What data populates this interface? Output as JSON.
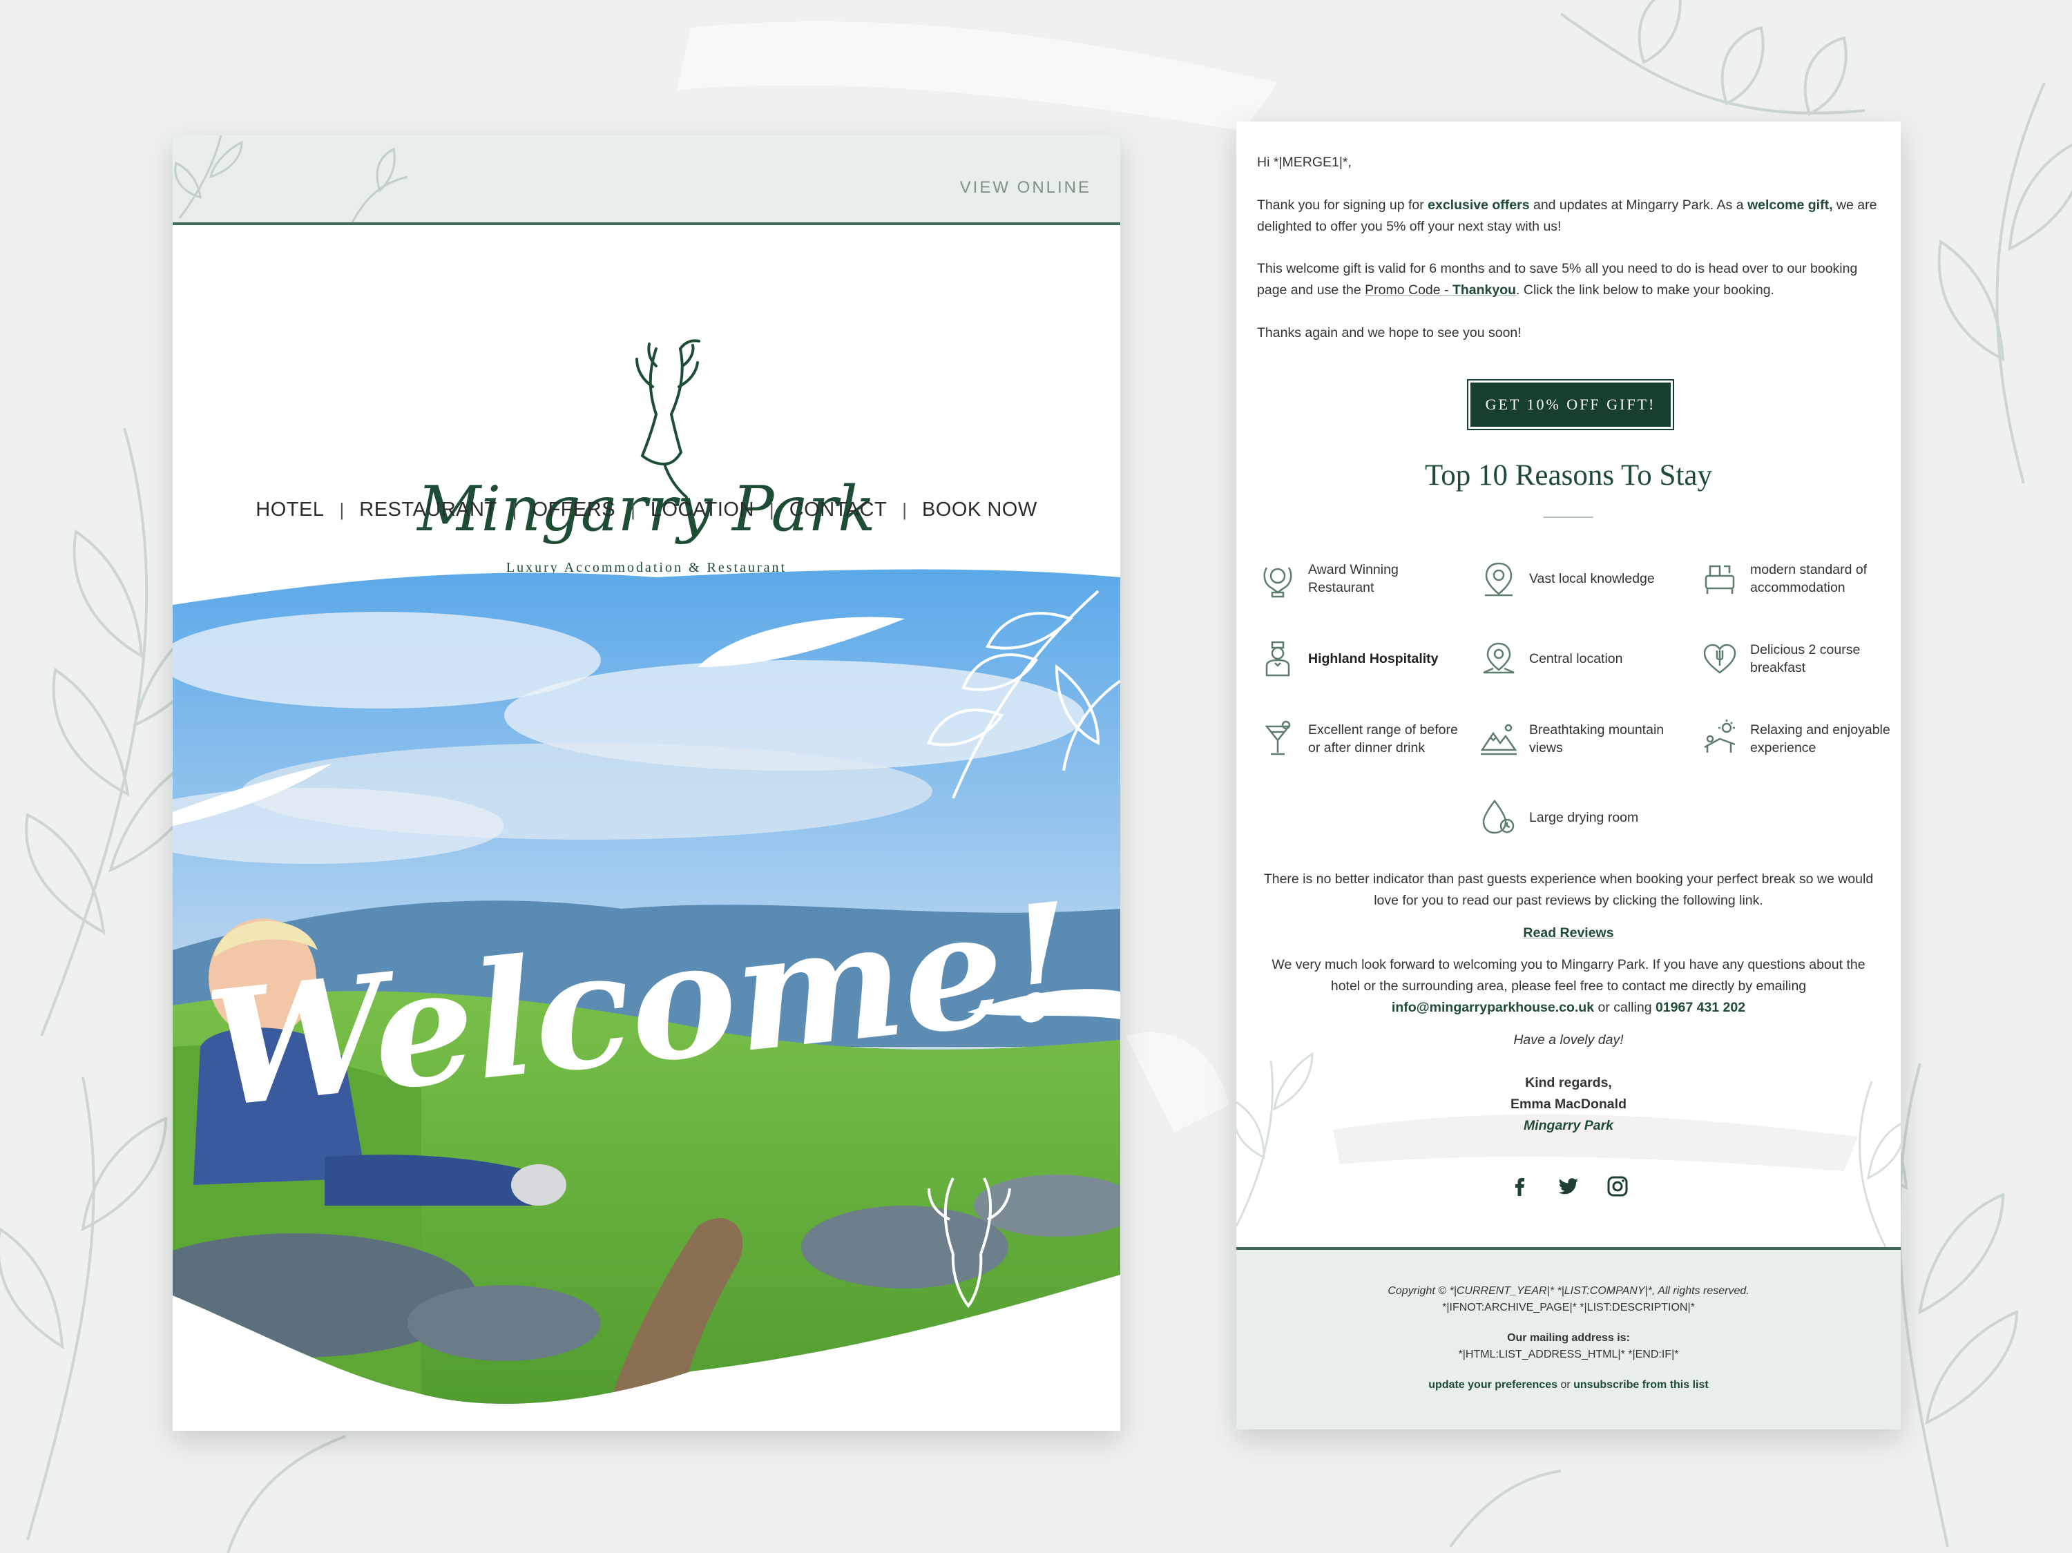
{
  "left_email": {
    "view_online": "VIEW ONLINE",
    "brand_name": "Mingarry Park",
    "brand_tagline": "Luxury Accommodation & Restaurant",
    "nav": [
      "HOTEL",
      "RESTAURANT",
      "OFFERS",
      "LOCATION",
      "CONTACT",
      "BOOK NOW"
    ],
    "nav_separator": "|",
    "hero_text": "Welcome!"
  },
  "right_email": {
    "greeting": "Hi *|MERGE1|*,",
    "p1_a": "Thank you for signing up for ",
    "p1_b": "exclusive offers",
    "p1_c": " and updates at Mingarry Park. As a ",
    "p1_d": "welcome gift,",
    "p1_e": " we are delighted to offer you 5% off your next stay with us!",
    "p2_a": "This welcome gift is valid for 6 months and to save 5% all you need to do is head over to our booking page and use the ",
    "p2_b": "Promo Code - ",
    "p2_c": "Thankyou",
    "p2_d": ". Click the link below to make your booking.",
    "p3": "Thanks again and we hope to see you soon!",
    "cta_label": "GET 10% OFF GIFT!",
    "reasons_title": "Top 10 Reasons To Stay",
    "reasons": [
      {
        "label": "Award Winning Restaurant",
        "icon": "laurel-icon",
        "bold": false
      },
      {
        "label": "Vast local knowledge",
        "icon": "map-pin-icon",
        "bold": false
      },
      {
        "label": "modern standard of accommodation",
        "icon": "armchair-icon",
        "bold": false
      },
      {
        "label": "Highland Hospitality",
        "icon": "butler-icon",
        "bold": true
      },
      {
        "label": "Central location",
        "icon": "location-icon",
        "bold": false
      },
      {
        "label": "Delicious 2 course breakfast",
        "icon": "heart-fork-icon",
        "bold": false
      },
      {
        "label": "Excellent range of before or after dinner drink",
        "icon": "cocktail-icon",
        "bold": false
      },
      {
        "label": "Breathtaking mountain views",
        "icon": "mountain-icon",
        "bold": false
      },
      {
        "label": "Relaxing and enjoyable experience",
        "icon": "sunbed-icon",
        "bold": false
      },
      {
        "label": "Large drying room",
        "icon": "droplet-icon",
        "bold": false
      }
    ],
    "reviews_text": "There is no better indicator than past guests experience when booking your perfect break so we would love for you to read our past reviews by clicking the following link.",
    "reviews_link": "Read Reviews",
    "contact_a": "We very much look forward to welcoming you to Mingarry Park. If you have any questions about the hotel or the surrounding area, please feel free to contact me directly by emailing ",
    "contact_email": "info@mingarryparkhouse.co.uk",
    "contact_b": " or calling ",
    "contact_phone": "01967 431 202",
    "closing": "Have a lovely day!",
    "regards": "Kind regards,",
    "signer_name": "Emma MacDonald",
    "signer_company": "Mingarry Park",
    "social": [
      "facebook-icon",
      "twitter-icon",
      "instagram-icon"
    ],
    "footer": {
      "copyright": "Copyright © *|CURRENT_YEAR|* *|LIST:COMPANY|*, All rights reserved.",
      "archive": "*|IFNOT:ARCHIVE_PAGE|* *|LIST:DESCRIPTION|*",
      "mailing_label": "Our mailing address is:",
      "mailing_value": "*|HTML:LIST_ADDRESS_HTML|* *|END:IF|*",
      "prefs_link": "update your preferences",
      "or": " or ",
      "unsub_link": "unsubscribe from this list"
    }
  },
  "colors": {
    "brand_green": "#1f4a36",
    "cta_green": "#173f2e",
    "header_bg": "#e8eeea",
    "accent_line": "#3f6a57"
  }
}
